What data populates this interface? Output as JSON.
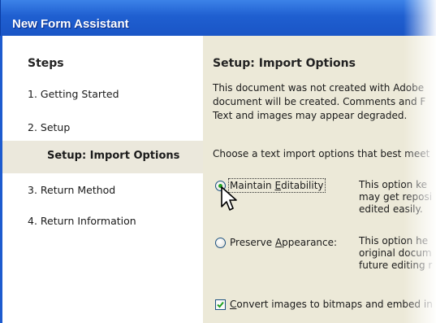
{
  "window": {
    "title": "New Form Assistant"
  },
  "steps": {
    "heading": "Steps",
    "items": [
      {
        "label": "1. Getting Started"
      },
      {
        "label": "2. Setup"
      },
      {
        "label": "Setup: Import Options",
        "active": true
      },
      {
        "label": "3. Return Method"
      },
      {
        "label": "4. Return Information"
      }
    ]
  },
  "content": {
    "heading": "Setup: Import Options",
    "description": [
      "This document was not created with Adobe",
      "document will be created.  Comments and F",
      "Text and images may appear degraded."
    ],
    "prompt": "Choose a text import options that best meet",
    "options": [
      {
        "label_before": "Maintain ",
        "label_mnemonic": "E",
        "label_after": "ditability",
        "selected": true,
        "desc": [
          "This option ke",
          "may get reposi",
          "edited easily."
        ]
      },
      {
        "label_before": "Preserve ",
        "label_mnemonic": "A",
        "label_after": "ppearance:",
        "selected": false,
        "desc": [
          "This option he",
          "original docum",
          "future editing r"
        ]
      }
    ],
    "convert_checkbox": {
      "label_mnemonic": "C",
      "label_rest": "onvert images to bitmaps and embed in",
      "checked": true
    }
  },
  "colors": {
    "titlebar": "#1f5fd0",
    "background": "#ece9d8",
    "radio_selected": "#21a121"
  }
}
